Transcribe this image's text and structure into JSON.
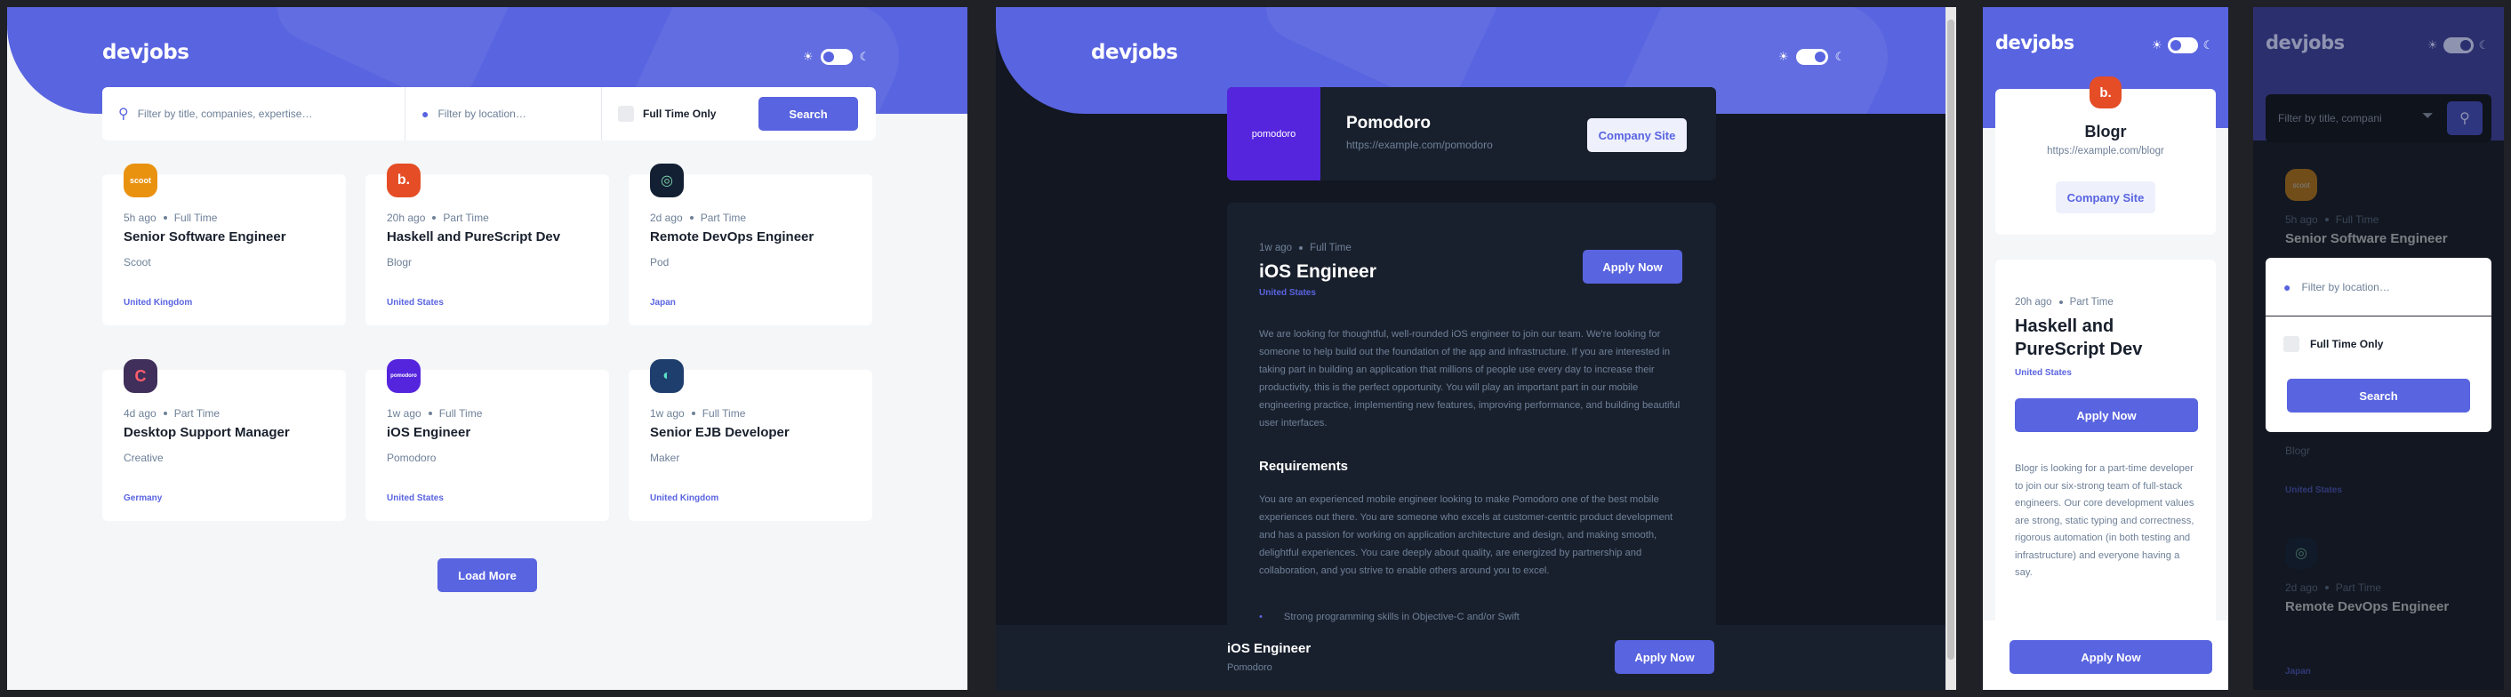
{
  "app": {
    "logo": "devjobs",
    "sun_icon": "sun-icon",
    "moon_icon": "moon-icon"
  },
  "colors": {
    "accent": "#5964e0",
    "light_bg": "#f4f6f8",
    "dark_bg": "#121721",
    "dark_card": "#19202d",
    "text_dark": "#19202d",
    "text_gray": "#6e8098"
  },
  "search": {
    "title_placeholder": "Filter by title, companies, expertise…",
    "location_placeholder": "Filter by location…",
    "fulltime_label": "Full Time Only",
    "button": "Search",
    "mobile_title_placeholder": "Filter by title, compani",
    "modal_location_placeholder": "Filter by location…",
    "modal_fulltime_label": "Full Time Only",
    "modal_button": "Search"
  },
  "jobs": [
    {
      "logo_text": "scoot",
      "logo_bg": "#e99210",
      "posted": "5h ago",
      "contract": "Full Time",
      "position": "Senior Software Engineer",
      "company": "Scoot",
      "location": "United Kingdom"
    },
    {
      "logo_text": "b.",
      "logo_bg": "#e54d26",
      "posted": "20h ago",
      "contract": "Part Time",
      "position": "Haskell and PureScript Dev",
      "company": "Blogr",
      "location": "United States"
    },
    {
      "logo_text": "◎",
      "logo_bg": "#132034",
      "posted": "2d ago",
      "contract": "Part Time",
      "position": "Remote DevOps Engineer",
      "company": "Pod",
      "location": "Japan"
    },
    {
      "logo_text": "C",
      "logo_bg": "#3f2f5a",
      "posted": "4d ago",
      "contract": "Part Time",
      "position": "Desktop Support Manager",
      "company": "Creative",
      "location": "Germany"
    },
    {
      "logo_text": "pomodoro",
      "logo_bg": "#5525de",
      "posted": "1w ago",
      "contract": "Full Time",
      "position": "iOS Engineer",
      "company": "Pomodoro",
      "location": "United States"
    },
    {
      "logo_text": "◐",
      "logo_bg": "#1e3f6e",
      "posted": "1w ago",
      "contract": "Full Time",
      "position": "Senior EJB Developer",
      "company": "Maker",
      "location": "United Kingdom"
    }
  ],
  "load_more": "Load More",
  "detail": {
    "company_logo_text": "pomodoro",
    "company": "Pomodoro",
    "website": "https://example.com/pomodoro",
    "company_site_button": "Company Site",
    "posted": "1w ago",
    "contract": "Full Time",
    "position": "iOS Engineer",
    "location": "United States",
    "apply": "Apply Now",
    "description": "We are looking for thoughtful, well-rounded iOS engineer to join our team. We're looking for someone to help build out the foundation of the app and infrastructure. If you are interested in taking part in building an application that millions of people use every day to increase their productivity, this is the perfect opportunity. You will play an important part in our mobile engineering practice, implementing new features, improving performance, and building beautiful user interfaces.",
    "requirements_heading": "Requirements",
    "requirements_text": "You are an experienced mobile engineer looking to make Pomodoro one of the best mobile experiences out there. You are someone who excels at customer-centric product development and has a passion for working on application architecture and design, and making smooth, delightful experiences. You care deeply about quality, are energized by partnership and collaboration, and you strive to enable others around you to excel.",
    "requirement_item": "Strong programming skills in Objective-C and/or Swift",
    "footer_title": "iOS Engineer",
    "footer_company": "Pomodoro",
    "footer_apply": "Apply Now"
  },
  "mobile_detail": {
    "logo_text": "b.",
    "company": "Blogr",
    "website": "https://example.com/blogr",
    "company_site_button": "Company Site",
    "posted": "20h ago",
    "contract": "Part Time",
    "position": "Haskell and PureScript Dev",
    "location": "United States",
    "apply": "Apply Now",
    "description": "Blogr is looking for a part-time developer to join our six-strong team of full-stack engineers. Our core development values are strong, static typing and correctness, rigorous automation (in both testing and infrastructure) and everyone having a say.",
    "footer_apply": "Apply Now"
  },
  "mobile_list": {
    "job1_logo": "scoot",
    "job1_posted": "5h ago",
    "job1_contract": "Full Time",
    "job1_position": "Senior Software Engineer",
    "job2_company": "Blogr",
    "job2_location": "United States",
    "job3_posted": "2d ago",
    "job3_contract": "Part Time",
    "job3_position": "Remote DevOps Engineer",
    "job3_location": "Japan"
  }
}
